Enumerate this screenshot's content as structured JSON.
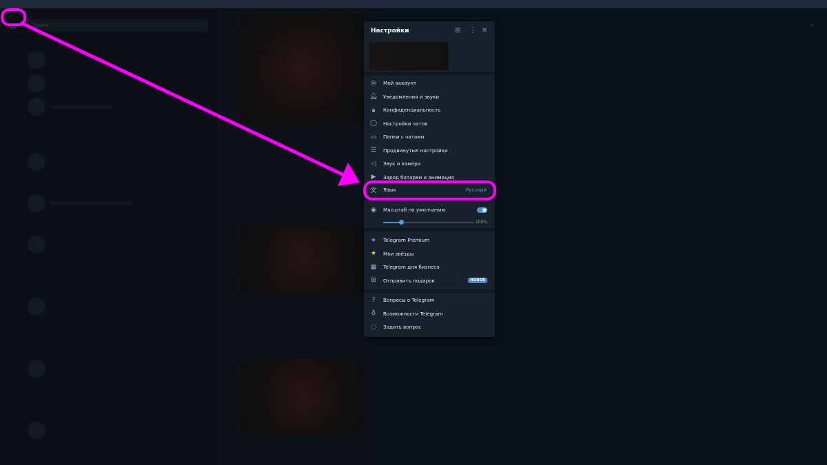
{
  "search": {
    "placeholder": "Поиск"
  },
  "settings": {
    "title": "Настройки",
    "items": [
      {
        "label": "Мой аккаунт",
        "icon": "account-icon",
        "glyph": "◎"
      },
      {
        "label": "Уведомления и звуки",
        "icon": "bell-icon",
        "glyph": "🔔︎"
      },
      {
        "label": "Конфиденциальность",
        "icon": "lock-icon",
        "glyph": "🔒︎"
      },
      {
        "label": "Настройки чатов",
        "icon": "chat-bubble-icon",
        "glyph": "◯"
      },
      {
        "label": "Папки с чатами",
        "icon": "folder-icon",
        "glyph": "▭"
      },
      {
        "label": "Продвинутые настройки",
        "icon": "sliders-icon",
        "glyph": "☰"
      },
      {
        "label": "Звук и камера",
        "icon": "speaker-icon",
        "glyph": "◁"
      },
      {
        "label": "Заряд батареи и анимация",
        "icon": "battery-icon",
        "glyph": "▶"
      }
    ],
    "language": {
      "label": "Язык",
      "value": "Русский",
      "glyph": "文"
    },
    "scale": {
      "label": "Масштаб по умолчанию",
      "enabled": true,
      "percent_label": "100%",
      "slider_fraction": 0.2
    },
    "premium_items": [
      {
        "label": "Telegram Premium",
        "icon": "premium-star-icon",
        "glyph": "★",
        "color": "#8a6cf0"
      },
      {
        "label": "Мои звёзды",
        "icon": "star-icon",
        "glyph": "★",
        "color": "#f5c433"
      },
      {
        "label": "Telegram для бизнеса",
        "icon": "store-icon",
        "glyph": "▦",
        "color": "#a8b1bc"
      },
      {
        "label": "Отправить подарок",
        "icon": "gift-icon",
        "glyph": "⊞",
        "color": "#a8b1bc",
        "badge": "НОВОЕ"
      }
    ],
    "help_items": [
      {
        "label": "Вопросы о Telegram",
        "icon": "question-icon",
        "glyph": "?"
      },
      {
        "label": "Возможности Telegram",
        "icon": "lightbulb-icon",
        "glyph": "♁"
      },
      {
        "label": "Задать вопрос",
        "icon": "chat-question-icon",
        "glyph": "◌"
      }
    ]
  },
  "colors": {
    "annotation": "#ff00ff",
    "accent": "#4f8fcf"
  }
}
